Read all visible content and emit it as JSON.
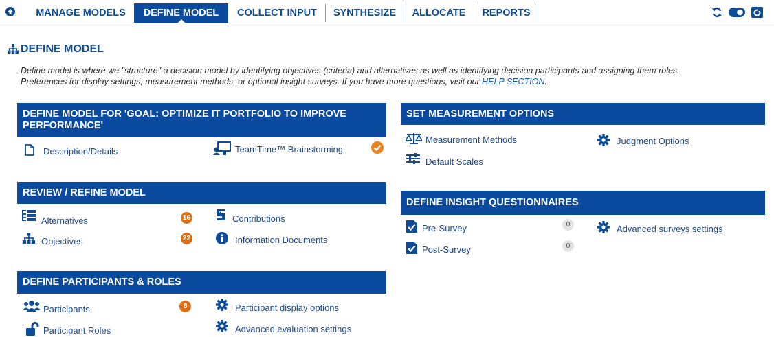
{
  "nav": {
    "tabs": [
      {
        "label": "MANAGE MODELS"
      },
      {
        "label": "DEFINE MODEL",
        "active": true
      },
      {
        "label": "COLLECT INPUT"
      },
      {
        "label": "SYNTHESIZE"
      },
      {
        "label": "ALLOCATE"
      },
      {
        "label": "REPORTS"
      }
    ],
    "right_icons": [
      "refresh-icon",
      "toggle-icon",
      "screenshot-icon"
    ]
  },
  "header": {
    "title": "DEFINE MODEL",
    "intro_line1": "Define model is where we \"structure\" a decision model by identifying objectives (criteria) and alternatives as well as identifying decision participants and assigning them roles.",
    "intro_line2_prefix": "Preferences for display settings, measurement methods, or optional insight surveys. If you have more questions, visit our ",
    "help_link": "HELP SECTION",
    "intro_line2_suffix": "."
  },
  "define_model": {
    "title": "DEFINE MODEL FOR 'GOAL: OPTIMIZE IT PORTFOLIO TO IMPROVE PERFORMANCE'",
    "description": "Description/Details",
    "brainstorming": "TeamTime™ Brainstorming"
  },
  "review": {
    "title": "REVIEW / REFINE MODEL",
    "alternatives": "Alternatives",
    "alternatives_count": "16",
    "objectives": "Objectives",
    "objectives_count": "22",
    "contributions": "Contributions",
    "info_docs": "Information Documents"
  },
  "participants": {
    "title": "DEFINE PARTICIPANTS & ROLES",
    "participants": "Participants",
    "participants_count": "8",
    "roles": "Participant Roles",
    "display_options": "Participant display options",
    "advanced_eval": "Advanced evaluation settings"
  },
  "measurement": {
    "title": "SET MEASUREMENT OPTIONS",
    "methods": "Measurement Methods",
    "scales": "Default Scales",
    "judgment": "Judgment Options"
  },
  "insight": {
    "title": "DEFINE INSIGHT QUESTIONNAIRES",
    "pre": "Pre-Survey",
    "pre_count": "0",
    "post": "Post-Survey",
    "post_count": "0",
    "advanced_surveys": "Advanced surveys settings"
  },
  "colors": {
    "brand": "#0a4a9f",
    "accent": "#e06d12",
    "link": "#1c4a8a"
  }
}
